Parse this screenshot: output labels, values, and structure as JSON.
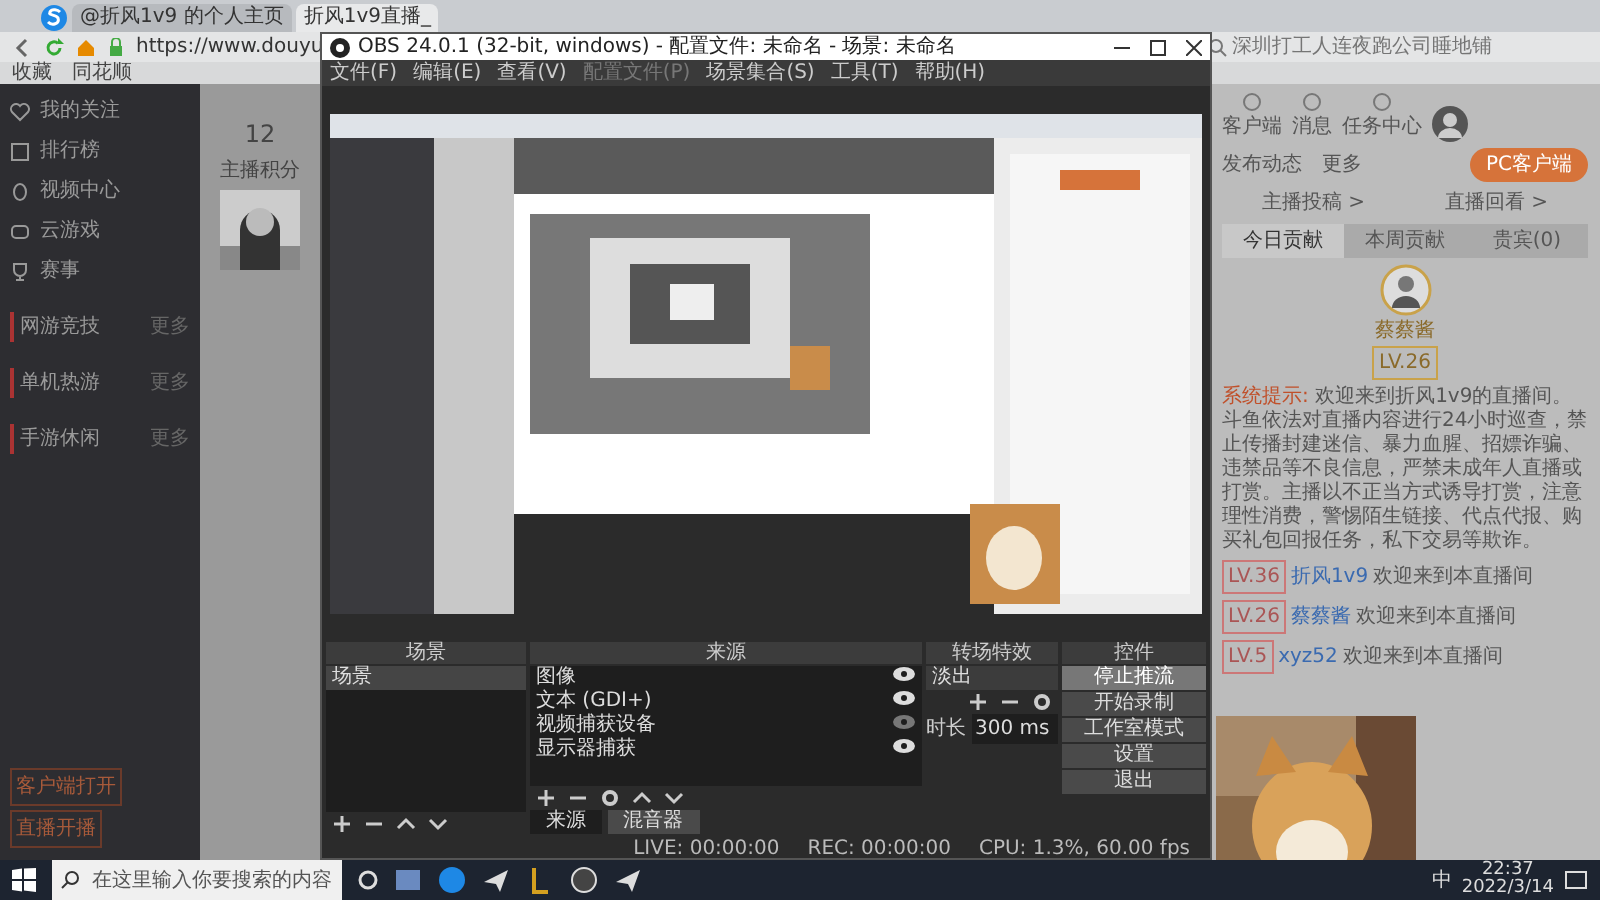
{
  "browser": {
    "tabs": [
      {
        "label": "@折风1v9 的个人主页",
        "selected": false
      },
      {
        "label": "折风1v9直播_",
        "selected": true
      }
    ],
    "url": "https://www.douyu",
    "search_placeholder": "深圳打工人连夜跑公司睡地铺",
    "bookmarks": [
      "收藏",
      "同花顺"
    ]
  },
  "sidebar": {
    "items": [
      "我的关注",
      "排行榜",
      "视频中心",
      "云游戏",
      "赛事"
    ],
    "sections": [
      {
        "title": "网游竞技",
        "more": "更多"
      },
      {
        "title": "单机热游",
        "more": "更多"
      },
      {
        "title": "手游休闲",
        "more": "更多"
      }
    ],
    "buttons": [
      "客户端打开",
      "直播开播"
    ]
  },
  "profile": {
    "score": "12",
    "score_label": "主播积分"
  },
  "right_panel": {
    "top_icons": [
      "客户端",
      "消息",
      "任务中心"
    ],
    "actions": [
      "发布动态",
      "更多"
    ],
    "client_button": "PC客户端",
    "links": [
      "主播投稿 >",
      "直播回看 >"
    ],
    "tabs": [
      {
        "label": "今日贡献",
        "selected": true
      },
      {
        "label": "本周贡献",
        "selected": false
      },
      {
        "label": "贵宾(0)",
        "selected": false
      }
    ],
    "top_user": "蔡蔡酱",
    "top_level": "LV.26",
    "system_label": "系统提示:",
    "system_text": "欢迎来到折风1v9的直播间。斗鱼依法对直播内容进行24小时巡查，禁止传播封建迷信、暴力血腥、招嫖诈骗、违禁品等不良信息，严禁未成年人直播或打赏。主播以不正当方式诱导打赏，注意理性消费，警惕陌生链接、代点代报、购买礼包回报任务，私下交易等欺诈。",
    "chat": [
      {
        "badge": "LV.36",
        "user": "折风1v9",
        "text": "欢迎来到本直播间"
      },
      {
        "badge": "LV.26",
        "user": "蔡蔡酱",
        "text": "欢迎来到本直播间"
      },
      {
        "badge": "LV.5",
        "user": "xyz52",
        "text": "欢迎来到本直播间"
      }
    ]
  },
  "obs": {
    "title": "OBS 24.0.1 (32-bit, windows) - 配置文件: 未命名 - 场景: 未命名",
    "menu": [
      {
        "label": "文件(F)",
        "disabled": false
      },
      {
        "label": "编辑(E)",
        "disabled": false
      },
      {
        "label": "查看(V)",
        "disabled": false
      },
      {
        "label": "配置文件(P)",
        "disabled": true
      },
      {
        "label": "场景集合(S)",
        "disabled": false
      },
      {
        "label": "工具(T)",
        "disabled": false
      },
      {
        "label": "帮助(H)",
        "disabled": false
      }
    ],
    "docks": {
      "scenes_title": "场景",
      "scenes": [
        {
          "label": "场景",
          "selected": true
        }
      ],
      "sources_title": "来源",
      "sources": [
        {
          "label": "图像",
          "visible": true
        },
        {
          "label": "文本 (GDI+)",
          "visible": true
        },
        {
          "label": "视频捕获设备",
          "visible": false
        },
        {
          "label": "显示器捕获",
          "visible": true
        }
      ],
      "source_tabs": [
        {
          "label": "来源",
          "selected": true
        },
        {
          "label": "混音器",
          "selected": false
        }
      ],
      "transitions_title": "转场特效",
      "transition": "淡出",
      "duration_label": "时长",
      "duration": "300 ms",
      "controls_title": "控件",
      "controls": [
        {
          "label": "停止推流",
          "active": true
        },
        {
          "label": "开始录制",
          "active": false
        },
        {
          "label": "工作室模式",
          "active": false
        },
        {
          "label": "设置",
          "active": false
        },
        {
          "label": "退出",
          "active": false
        }
      ]
    },
    "status": [
      "LIVE: 00:00:00",
      "REC: 00:00:00",
      "CPU: 1.3%, 60.00 fps"
    ]
  },
  "taskbar": {
    "search_placeholder": "在这里输入你要搜索的内容",
    "ime": "中",
    "time": "22:37",
    "date": "2022/3/14"
  }
}
